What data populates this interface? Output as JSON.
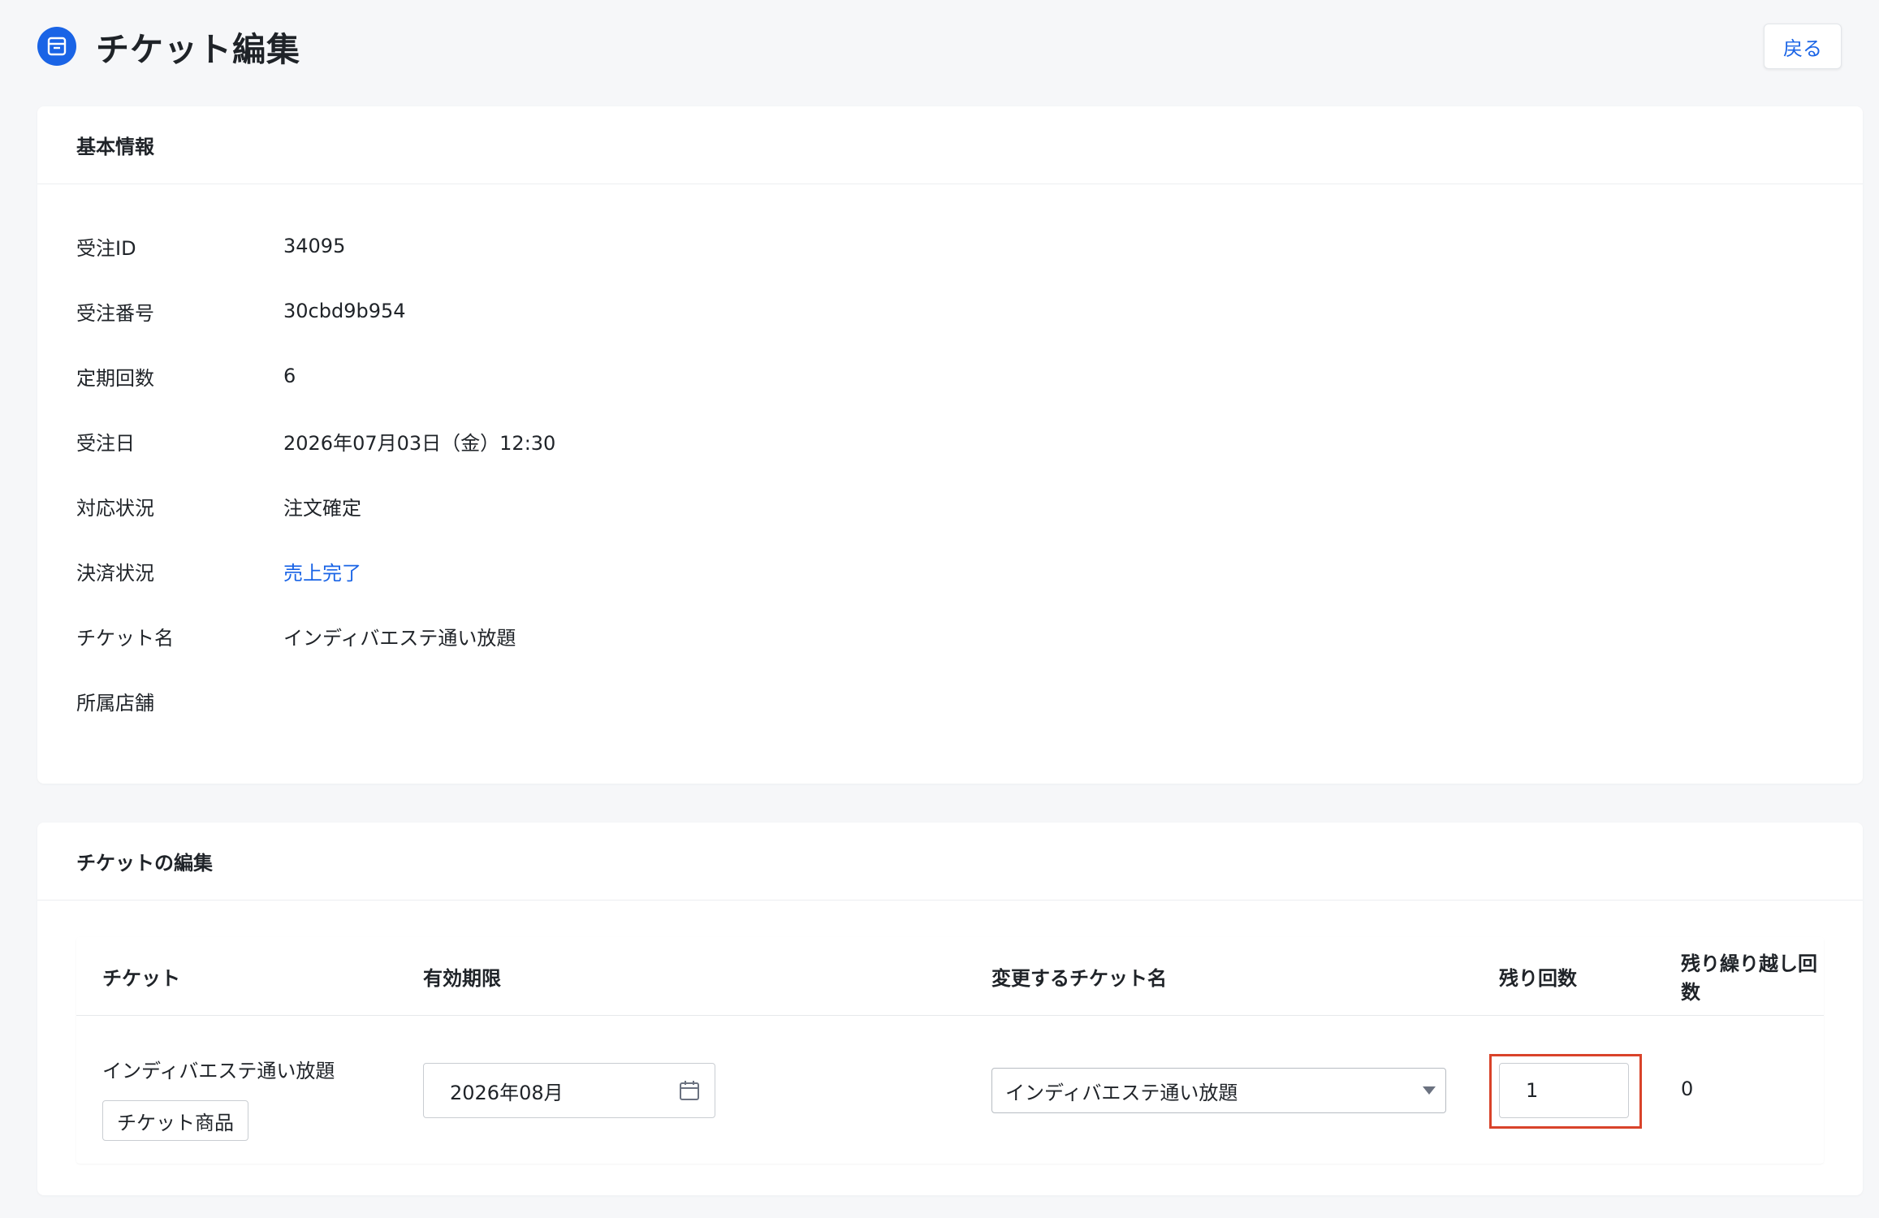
{
  "header": {
    "title": "チケット編集",
    "icon": "ticket-icon",
    "back_label": "戻る"
  },
  "colors": {
    "accent": "#1a64e6",
    "highlight": "#d9432a"
  },
  "basic_info": {
    "title": "基本情報",
    "rows": [
      {
        "label": "受注ID",
        "value": "34095"
      },
      {
        "label": "受注番号",
        "value": "30cbd9b954"
      },
      {
        "label": "定期回数",
        "value": "6"
      },
      {
        "label": "受注日",
        "value": "2026年07月03日（金）12:30"
      },
      {
        "label": "対応状況",
        "value": "注文確定"
      },
      {
        "label": "決済状況",
        "value": "売上完了"
      },
      {
        "label": "チケット名",
        "value": "インディバエステ通い放題"
      },
      {
        "label": "所属店舗",
        "value": ""
      }
    ]
  },
  "ticket_edit": {
    "title": "チケットの編集",
    "columns": [
      "チケット",
      "有効期限",
      "変更するチケット名",
      "残り回数",
      "残り繰り越し回数"
    ],
    "row": {
      "ticket_name": "インディバエステ通い放題",
      "tag_label": "チケット商品",
      "expiry_value": "2026年08月",
      "selected_ticket": "インディバエステ通い放題",
      "remaining_count": "1",
      "carryover_count": "0"
    }
  }
}
